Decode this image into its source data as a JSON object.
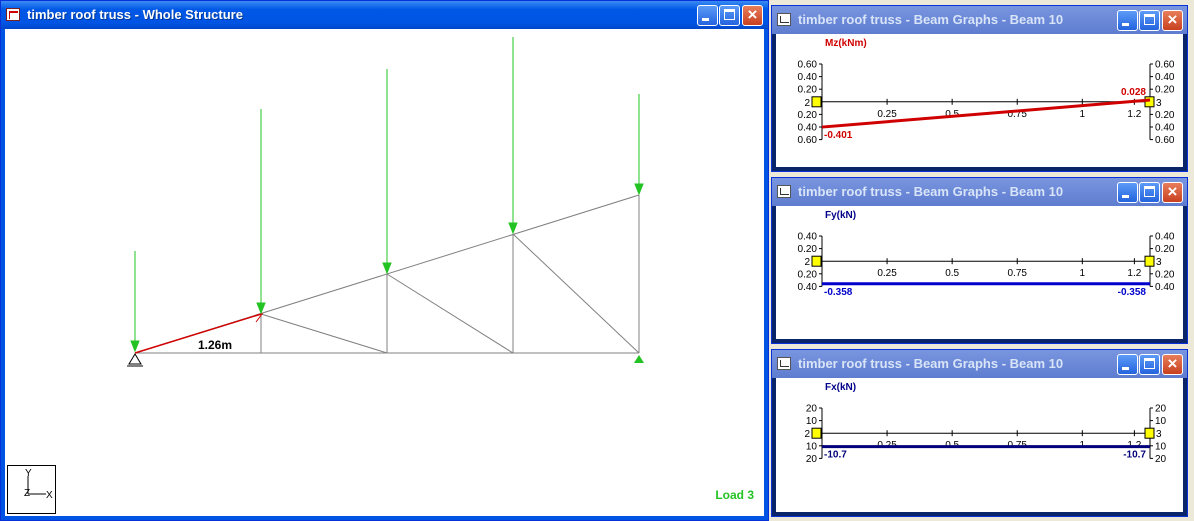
{
  "main_window": {
    "title": "timber roof truss - Whole Structure",
    "dimension_label": "1.26m",
    "load_label": "Load 3",
    "axis": {
      "y": "Y",
      "z": "Z",
      "x": "X"
    }
  },
  "graph_windows": [
    {
      "title": "timber roof truss - Beam Graphs - Beam 10",
      "quantity": "Mz(kNm)",
      "quantity_color": "#D00000",
      "line_color": "#D00000",
      "y_ticks": [
        "0.60",
        "0.40",
        "0.20",
        "2",
        "0.20",
        "0.40",
        "0.60"
      ],
      "right_ticks": [
        "0.60",
        "0.40",
        "0.20",
        "3",
        "0.20",
        "0.40",
        "0.60"
      ],
      "x_ticks": [
        "0.25",
        "0.5",
        "0.75",
        "1",
        "1.2"
      ],
      "start_value": "-0.401",
      "end_value": "0.028",
      "start_node": "2",
      "end_node": "3"
    },
    {
      "title": "timber roof truss - Beam Graphs - Beam 10",
      "quantity": "Fy(kN)",
      "quantity_color": "#00008B",
      "line_color": "#0000CC",
      "y_ticks": [
        "0.40",
        "0.20",
        "2",
        "0.20",
        "0.40"
      ],
      "right_ticks": [
        "0.40",
        "0.20",
        "3",
        "0.20",
        "0.40"
      ],
      "x_ticks": [
        "0.25",
        "0.5",
        "0.75",
        "1",
        "1.2"
      ],
      "start_value": "-0.358",
      "end_value": "-0.358",
      "start_node": "2",
      "end_node": "3"
    },
    {
      "title": "timber roof truss - Beam Graphs - Beam 10",
      "quantity": "Fx(kN)",
      "quantity_color": "#00008B",
      "line_color": "#00007A",
      "y_ticks": [
        "20",
        "10",
        "2",
        "10",
        "20"
      ],
      "right_ticks": [
        "20",
        "10",
        "3",
        "10",
        "20"
      ],
      "x_ticks": [
        "0.25",
        "0.5",
        "0.75",
        "1",
        "1.2"
      ],
      "start_value": "-10.7",
      "end_value": "-10.7",
      "start_node": "2",
      "end_node": "3"
    }
  ]
}
